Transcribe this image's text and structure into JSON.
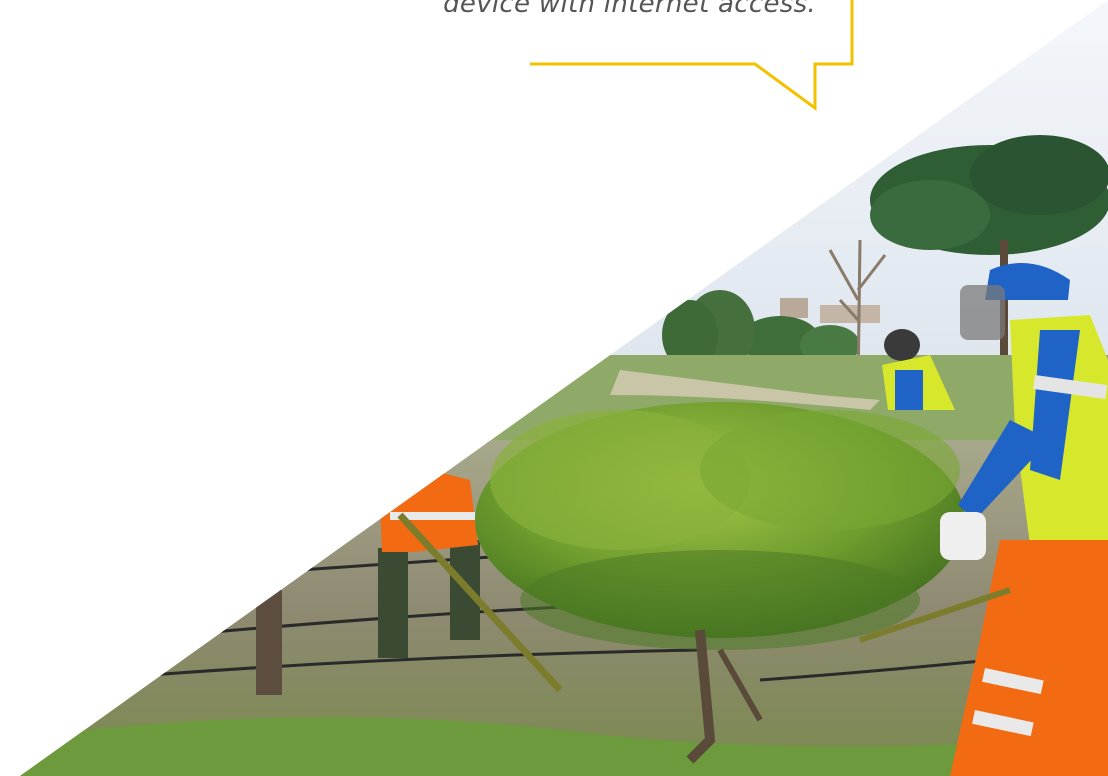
{
  "callout": {
    "text": "device with internet access.",
    "border_color": "#f2c200"
  },
  "photo": {
    "subject": "gardening workers in high-visibility orange, yellow and blue clothing trimming a green hedge in a park"
  },
  "colors": {
    "background": "#ffffff",
    "hedge": "#6f9d2e",
    "vest_yellow": "#d7e82c",
    "uniform_orange": "#f26a12",
    "uniform_blue": "#1f63c6"
  }
}
